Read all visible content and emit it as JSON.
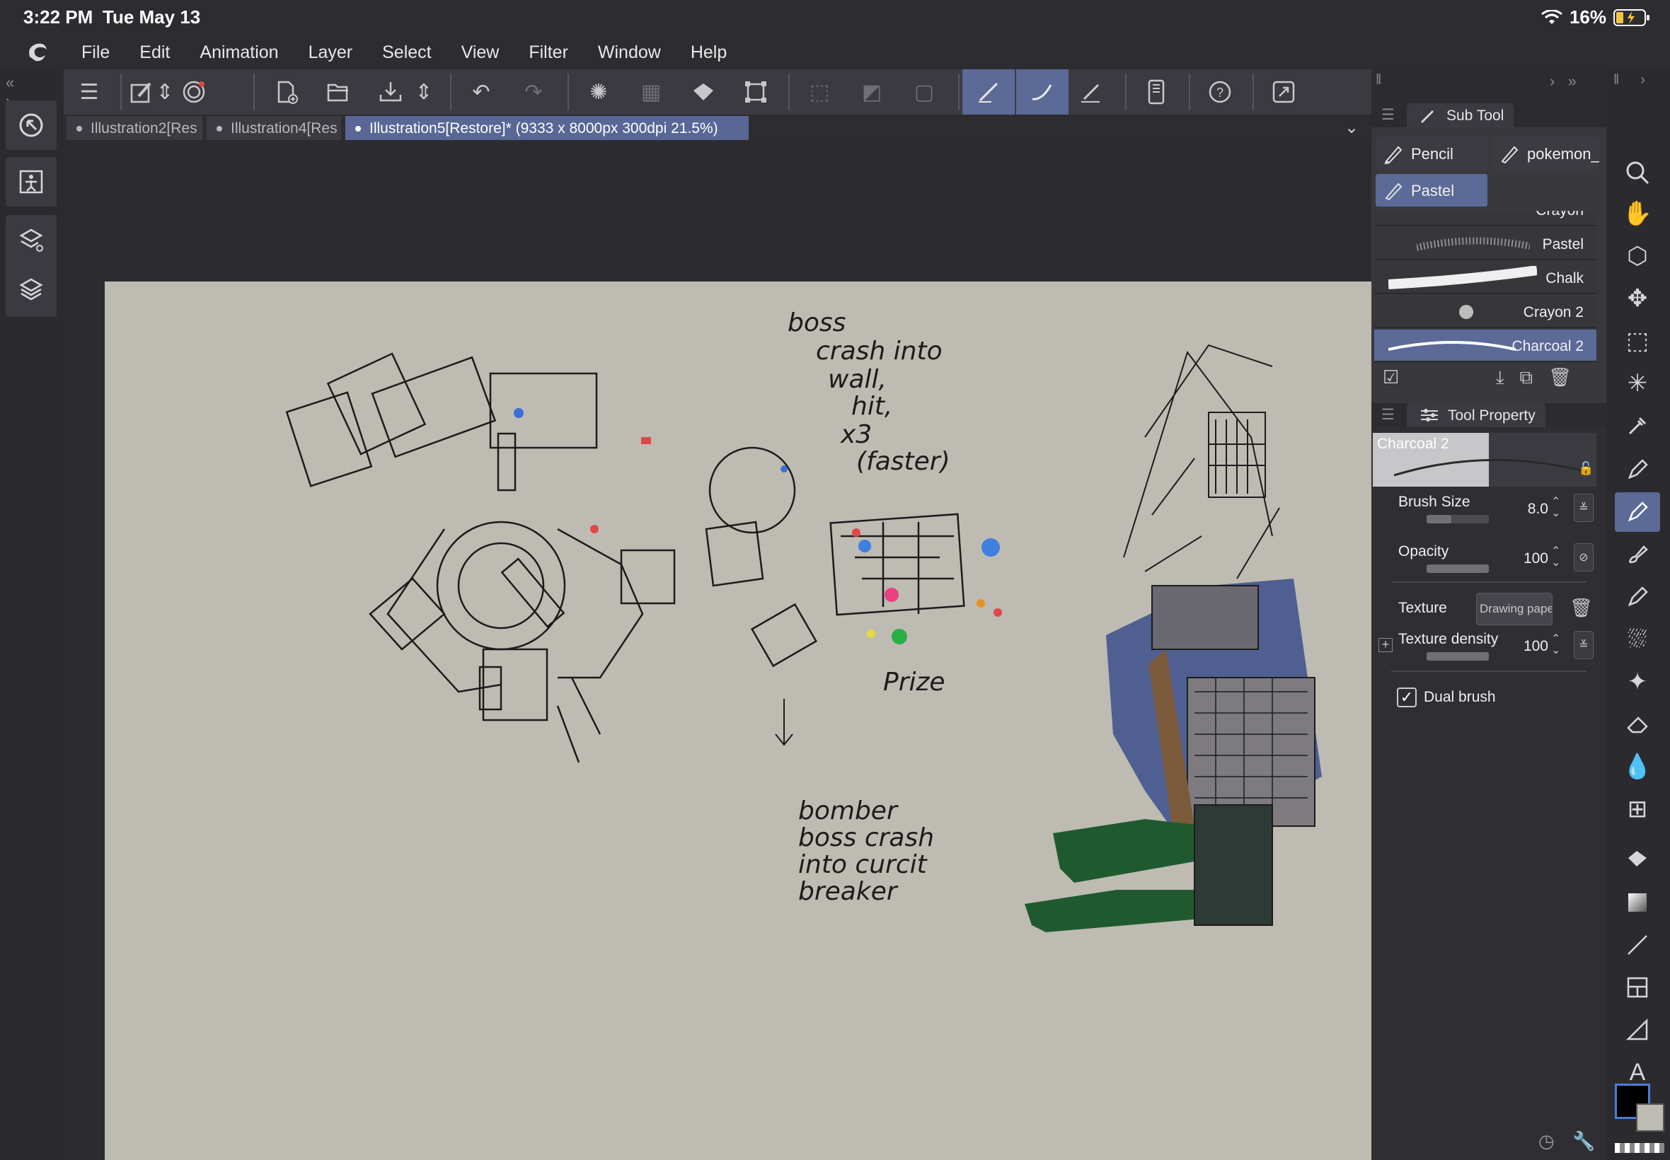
{
  "status": {
    "time": "3:22 PM",
    "date": "Tue May 13",
    "battery": "16%"
  },
  "menu": [
    "File",
    "Edit",
    "Animation",
    "Layer",
    "Select",
    "View",
    "Filter",
    "Window",
    "Help"
  ],
  "tabs": [
    {
      "label": "Illustration2[Res",
      "active": false
    },
    {
      "label": "Illustration4[Res",
      "active": false
    },
    {
      "label": "Illustration5[Restore]* (9333 x 8000px 300dpi 21.5%)",
      "active": true
    }
  ],
  "subtool": {
    "title": "Sub Tool",
    "buttons": [
      "Pencil",
      "pokemon_s",
      "Pastel"
    ],
    "brushes": [
      "Crayon",
      "Pastel",
      "Chalk",
      "Crayon 2",
      "Charcoal 2"
    ],
    "selected_brush": "Charcoal 2"
  },
  "toolprop": {
    "title": "Tool Property",
    "brush_name": "Charcoal 2",
    "brush_size_label": "Brush Size",
    "brush_size": "8.0",
    "opacity_label": "Opacity",
    "opacity": "100",
    "texture_label": "Texture",
    "texture_value": "Drawing pape",
    "texture_density_label": "Texture density",
    "texture_density": "100",
    "dual_brush_label": "Dual brush",
    "dual_brush_checked": true
  },
  "sketch": {
    "note_top": [
      "boss",
      "crash into",
      "wall,",
      "hit,",
      "x3",
      "(faster)"
    ],
    "note_bottom": [
      "bomber",
      "boss crash",
      "into curcit",
      "breaker"
    ],
    "prize": "Prize",
    "colors": {
      "house_blue": "#4f5f92",
      "grass_green": "#1f5a2e",
      "brick": "#7a5a3a"
    }
  },
  "accent": "#5b6a96"
}
